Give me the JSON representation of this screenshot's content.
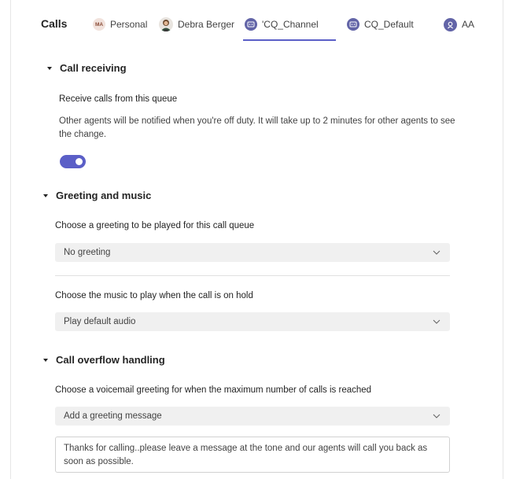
{
  "tabs": {
    "title": "Calls",
    "items": [
      {
        "label": "Personal",
        "avatar_text": "MA"
      },
      {
        "label": "Debra Berger"
      },
      {
        "label": "'CQ_Channel"
      },
      {
        "label": "CQ_Default"
      },
      {
        "label": "AA"
      }
    ],
    "active_index": 2,
    "accent_color": "#5b5fc7"
  },
  "call_receiving": {
    "heading": "Call receiving",
    "label": "Receive calls from this queue",
    "description": "Other agents will be notified when you're off duty. It will take up to 2 minutes for other agents to see the change.",
    "toggle_on": true
  },
  "greeting_music": {
    "heading": "Greeting and music",
    "greeting_label": "Choose a greeting to be played for this call queue",
    "greeting_value": "No greeting",
    "music_label": "Choose the music to play when the call is on hold",
    "music_value": "Play default audio"
  },
  "overflow": {
    "heading": "Call overflow handling",
    "voicemail_label": "Choose a voicemail greeting for when the maximum number of calls is reached",
    "voicemail_value": "Add a greeting message",
    "message_text": "Thanks for calling..please leave a message at the tone and our agents will call you back as soon as possible."
  },
  "icons": [
    "chevron-down-icon",
    "caret-down-icon",
    "call-queue-icon",
    "auto-attendant-icon",
    "avatar-photo"
  ]
}
